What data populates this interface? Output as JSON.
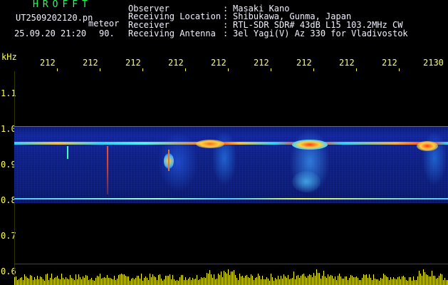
{
  "header": {
    "brand": "HROFFT",
    "filename": "UT2509202120.pn",
    "category": "meteor",
    "datetime": "25.09.20 21:20",
    "count": "90.",
    "observer_label": "Observer",
    "location_label": "Receiving Location",
    "receiver_label": "Receiver",
    "antenna_label": "Receiving Antenna",
    "sep": ":",
    "observer": "Masaki Kano",
    "location": "Shibukawa, Gunma, Japan",
    "receiver": "RTL-SDR SDR# 43dB L15 103.2MHz CW",
    "antenna": "3el Yagi(V) Az 330 for Vladivostok"
  },
  "axis": {
    "unit": "kHz",
    "y_labels": [
      "1.1",
      "1.0",
      "0.9",
      "0.8",
      "0.7",
      "0.6"
    ],
    "x_labels": [
      "212",
      "212",
      "212",
      "212",
      "212",
      "212",
      "212",
      "212",
      "212",
      "2130"
    ]
  },
  "colors": {
    "background": "#000000",
    "text": "#f2f2ff",
    "brand": "#27ff5a",
    "axis": "#ffff55",
    "spectrum_bg": "#101c88",
    "signal": "#ff3a1a",
    "amplitude": "#ffff00"
  }
}
